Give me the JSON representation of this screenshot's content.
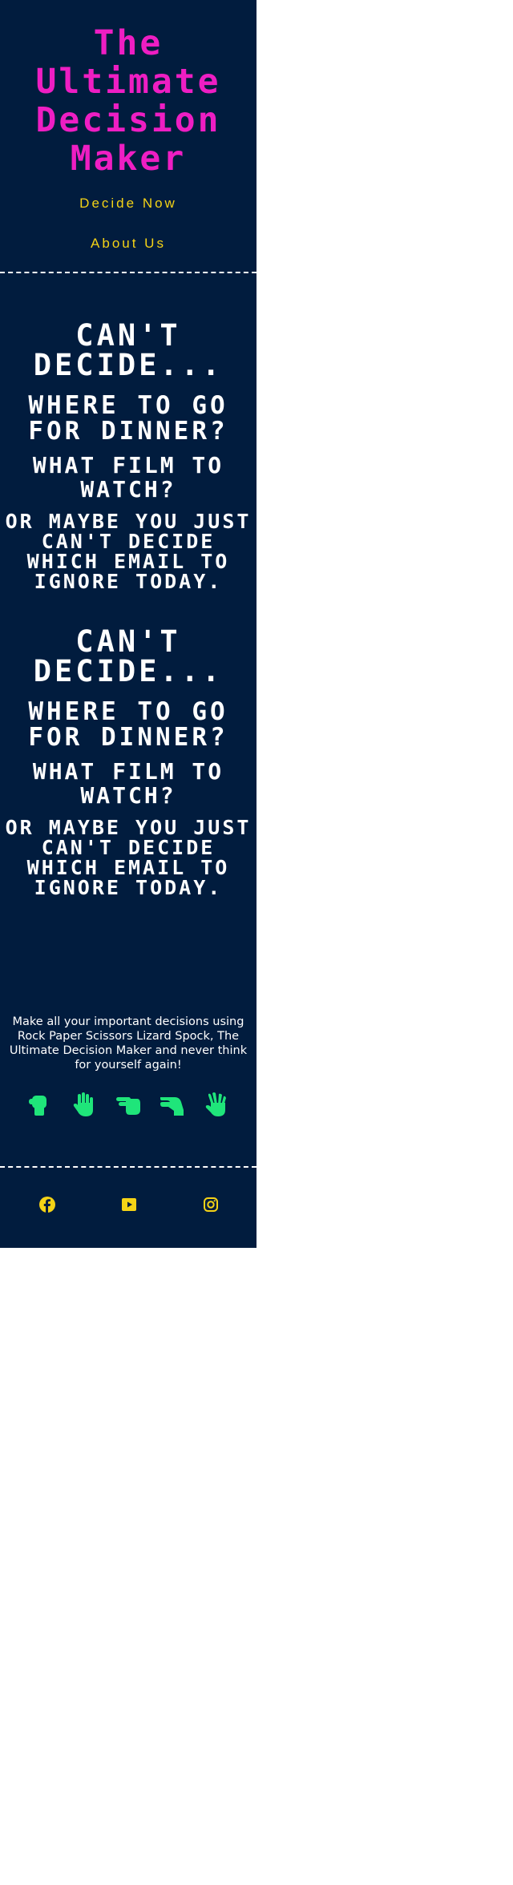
{
  "header": {
    "title_lines": [
      "The",
      "Ultimate",
      "Decision",
      "Maker"
    ],
    "nav": {
      "decide_now": "Decide Now",
      "about_us": "About Us"
    }
  },
  "scroller": {
    "lines": [
      "Can't Decide...",
      "where to go for dinner?",
      "what film to watch?",
      "or maybe you just can't decide which email to ignore today."
    ]
  },
  "tagline": "Make all your important decisions using Rock Paper Scissors Lizard Spock, The Ultimate Decision Maker and never think for yourself again!",
  "hands": {
    "icons": [
      "hand-rock-icon",
      "hand-paper-icon",
      "hand-scissors-icon",
      "hand-lizard-icon",
      "hand-spock-icon"
    ],
    "color": "#1fe57a"
  },
  "social": {
    "icons": [
      "facebook-icon",
      "youtube-icon",
      "instagram-icon"
    ],
    "color": "#f5d316"
  },
  "colors": {
    "background": "#011c3e",
    "title": "#ee1ec3",
    "nav": "#f5d316",
    "text": "#ffffff",
    "hands": "#1fe57a"
  }
}
